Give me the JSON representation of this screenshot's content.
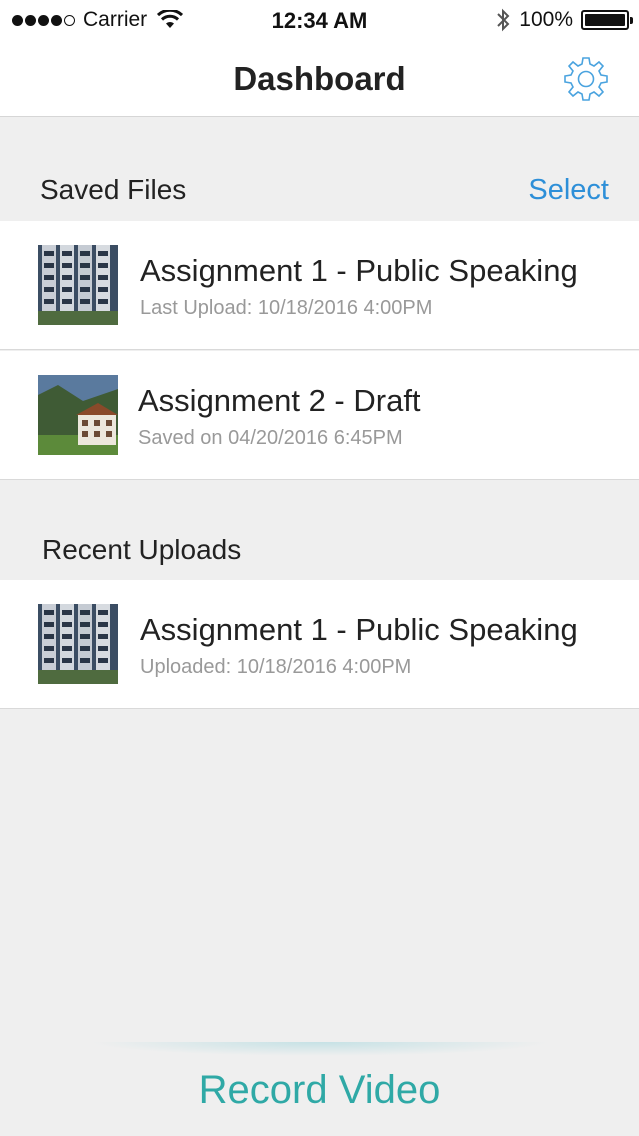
{
  "status_bar": {
    "carrier": "Carrier",
    "time": "12:34 AM",
    "battery_label": "100%",
    "battery_level": 1.0,
    "signal_bars": 4,
    "icons": [
      "signal-dots-icon",
      "wifi-icon",
      "bluetooth-icon",
      "battery-icon"
    ]
  },
  "nav": {
    "title": "Dashboard",
    "settings_icon": "gear-icon"
  },
  "saved_files": {
    "title": "Saved Files",
    "select_label": "Select",
    "items": [
      {
        "title": "Assignment 1 - Public Speaking",
        "subtitle": "Last Upload: 10/18/2016 4:00PM",
        "thumbnail": "building-thumbnail"
      },
      {
        "title": "Assignment 2 - Draft",
        "subtitle": "Saved on 04/20/2016 6:45PM",
        "thumbnail": "house-thumbnail"
      }
    ]
  },
  "recent_uploads": {
    "title": "Recent Uploads",
    "items": [
      {
        "title": "Assignment 1 - Public Speaking",
        "subtitle": "Uploaded: 10/18/2016 4:00PM",
        "thumbnail": "building-thumbnail"
      }
    ]
  },
  "footer": {
    "record_label": "Record Video"
  },
  "colors": {
    "accent_blue": "#2d8fd8",
    "record_teal": "#2fa9a6",
    "background": "#efefef",
    "subtitle_gray": "#999999"
  }
}
